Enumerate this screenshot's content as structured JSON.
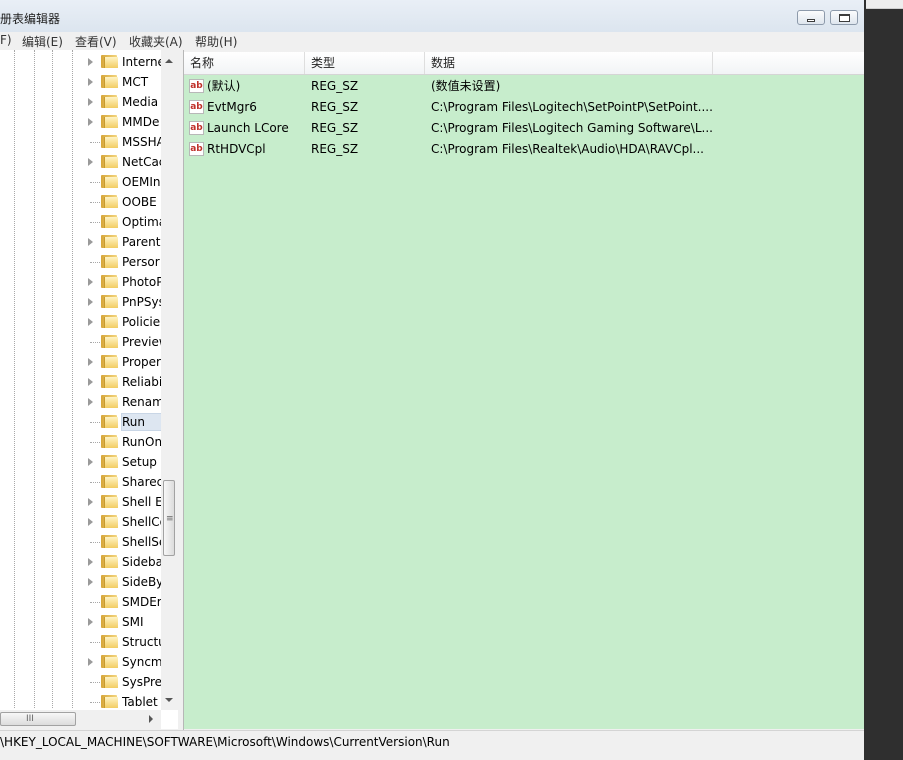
{
  "window": {
    "title": "册表编辑器"
  },
  "menubar": {
    "items": [
      "F)",
      "编辑(E)",
      "查看(V)",
      "收藏夹(A)",
      "帮助(H)"
    ]
  },
  "tree": {
    "items": [
      {
        "label": "Interne",
        "expandable": true
      },
      {
        "label": "MCT",
        "expandable": true
      },
      {
        "label": "Media",
        "expandable": true
      },
      {
        "label": "MMDe",
        "expandable": true
      },
      {
        "label": "MSSHA",
        "expandable": false
      },
      {
        "label": "NetCac",
        "expandable": true
      },
      {
        "label": "OEMIn",
        "expandable": false
      },
      {
        "label": "OOBE",
        "expandable": false
      },
      {
        "label": "Optima",
        "expandable": false
      },
      {
        "label": "Parent",
        "expandable": true
      },
      {
        "label": "Persor",
        "expandable": false
      },
      {
        "label": "PhotoP",
        "expandable": true
      },
      {
        "label": "PnPSys",
        "expandable": true
      },
      {
        "label": "Policie",
        "expandable": true
      },
      {
        "label": "Preview",
        "expandable": false
      },
      {
        "label": "Proper",
        "expandable": true
      },
      {
        "label": "Reliabi",
        "expandable": true
      },
      {
        "label": "Renam",
        "expandable": true
      },
      {
        "label": "Run",
        "expandable": false,
        "selected": true
      },
      {
        "label": "RunOn",
        "expandable": false
      },
      {
        "label": "Setup",
        "expandable": true
      },
      {
        "label": "Sharec",
        "expandable": false
      },
      {
        "label": "Shell E",
        "expandable": true
      },
      {
        "label": "ShellCo",
        "expandable": true
      },
      {
        "label": "ShellSe",
        "expandable": false
      },
      {
        "label": "Sideba",
        "expandable": true
      },
      {
        "label": "SideBy",
        "expandable": true
      },
      {
        "label": "SMDEr",
        "expandable": false
      },
      {
        "label": "SMI",
        "expandable": true
      },
      {
        "label": "Structu",
        "expandable": false
      },
      {
        "label": "Syncm",
        "expandable": true
      },
      {
        "label": "SysPre",
        "expandable": false
      },
      {
        "label": "Tablet",
        "expandable": false
      }
    ]
  },
  "list": {
    "columns": [
      "名称",
      "类型",
      "数据"
    ],
    "icon": "reg-string-icon",
    "rows": [
      {
        "name": "(默认)",
        "type": "REG_SZ",
        "data": "(数值未设置)"
      },
      {
        "name": "EvtMgr6",
        "type": "REG_SZ",
        "data": "C:\\Program Files\\Logitech\\SetPointP\\SetPoint...."
      },
      {
        "name": "Launch LCore",
        "type": "REG_SZ",
        "data": "C:\\Program Files\\Logitech Gaming Software\\L..."
      },
      {
        "name": "RtHDVCpl",
        "type": "REG_SZ",
        "data": "C:\\Program Files\\Realtek\\Audio\\HDA\\RAVCpl..."
      }
    ]
  },
  "statusbar": {
    "path": "\\HKEY_LOCAL_MACHINE\\SOFTWARE\\Microsoft\\Windows\\CurrentVersion\\Run"
  },
  "colors": {
    "list_background": "#c7edcc",
    "selected_tree_item": "#dde6f1"
  }
}
